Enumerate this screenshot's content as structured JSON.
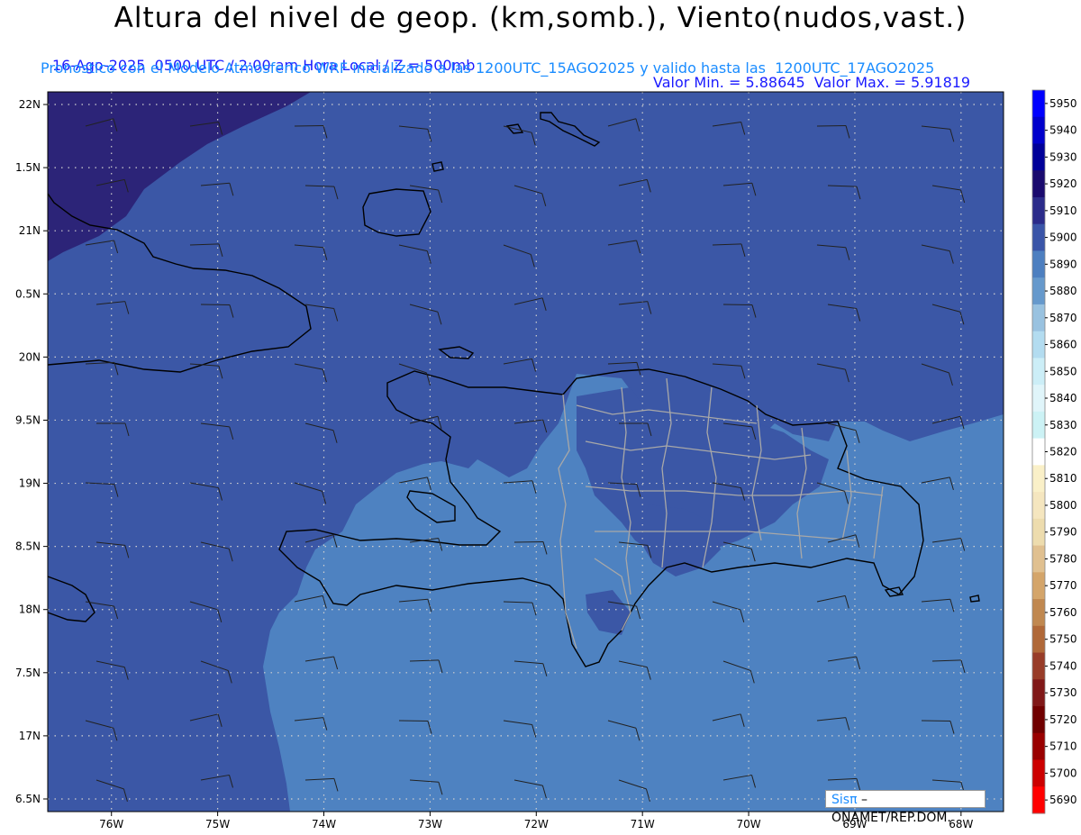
{
  "header": {
    "title": "Altura del nivel de geop. (km,somb.), Viento(nudos,vast.)",
    "date_time": "16-Ago-2025  0500 UTC / 2:00 am Hora Local / Z = 500mb",
    "minmax": "Valor Min. = 5.88645  Valor Max. = 5.91819",
    "model_info": "Pronostico con el Modelo Atmosferico WRF inicializado a las 1200UTC_15AGO2025 y valido hasta las  1200UTC_17AGO2025"
  },
  "axes": {
    "lat_labels": [
      "22N",
      "1.5N",
      "21N",
      "0.5N",
      "20N",
      "9.5N",
      "19N",
      "8.5N",
      "18N",
      "7.5N",
      "17N",
      "6.5N"
    ],
    "lat_values": [
      22,
      21.5,
      21,
      20.5,
      20,
      19.5,
      19,
      18.5,
      18,
      17.5,
      17,
      16.5
    ],
    "lon_labels": [
      "76W",
      "75W",
      "74W",
      "73W",
      "72W",
      "71W",
      "70W",
      "69W",
      "68W"
    ],
    "lon_values": [
      -76,
      -75,
      -74,
      -73,
      -72,
      -71,
      -70,
      -69,
      -68
    ],
    "lat_range": [
      16.4,
      22.1
    ],
    "lon_range": [
      -76.6,
      -67.6
    ]
  },
  "colorbar": {
    "labels": [
      "5950",
      "5940",
      "5930",
      "5920",
      "5910",
      "5900",
      "5890",
      "5880",
      "5870",
      "5860",
      "5850",
      "5840",
      "5830",
      "5820",
      "5810",
      "5800",
      "5790",
      "5780",
      "5770",
      "5760",
      "5750",
      "5740",
      "5730",
      "5720",
      "5710",
      "5700",
      "5690"
    ],
    "colors": [
      "#0000ff",
      "#0000cc",
      "#000099",
      "#1a0a6e",
      "#2b2b8a",
      "#3a55a8",
      "#4d7fc0",
      "#6699cc",
      "#99c2e0",
      "#b3dcf0",
      "#cceef7",
      "#e0f5fa",
      "#ccf2f5",
      "#ffffff",
      "#faf0c8",
      "#f5e6bf",
      "#eddcae",
      "#e0c090",
      "#d4a56a",
      "#c08850",
      "#b06838",
      "#983c28",
      "#801818",
      "#700000",
      "#990000",
      "#cc0000",
      "#ff0000"
    ]
  },
  "map": {
    "colors": {
      "level_5920": "#2c2478",
      "level_5910": "#3b57a6",
      "level_5900": "#4e82c1",
      "coast": "#000000",
      "province": "#a8a8a8",
      "grid": "#d0d0d0",
      "barb": "#222222"
    }
  },
  "credit": {
    "sis": "Sisπ",
    "org": " – ONAMET/REP.DOM."
  }
}
